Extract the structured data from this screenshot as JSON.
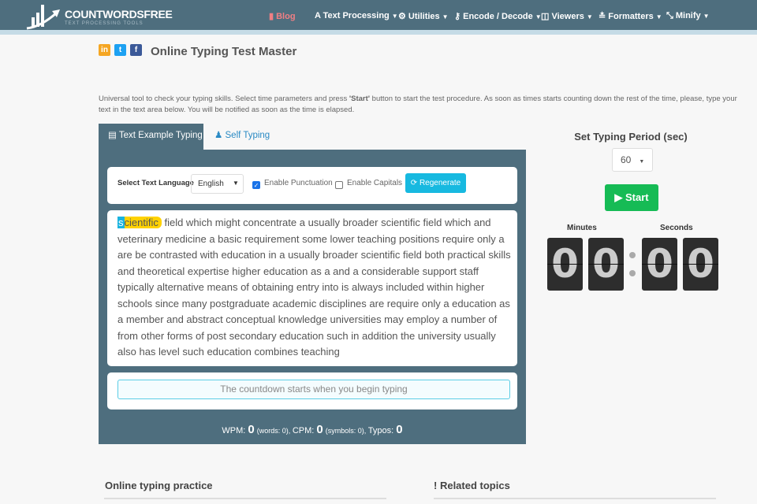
{
  "nav": {
    "logo_title": "COUNTWORDSFREE",
    "logo_subtitle": "TEXT PROCESSING TOOLS",
    "items": [
      {
        "label": "Blog",
        "icon": "book-icon"
      },
      {
        "label": "Text Processing",
        "icon": "font-icon"
      },
      {
        "label": "Utilities",
        "icon": "gear-icon"
      },
      {
        "label": "Encode / Decode",
        "icon": "key-icon"
      },
      {
        "label": "Viewers",
        "icon": "columns-icon"
      },
      {
        "label": "Formatters",
        "icon": "formatter-icon"
      },
      {
        "label": "Minify",
        "icon": "compress-icon"
      }
    ]
  },
  "social": [
    {
      "label": "in",
      "color": "#f5a623"
    },
    {
      "label": "t",
      "color": "#1da1f2"
    },
    {
      "label": "f",
      "color": "#3b5998"
    }
  ],
  "page_title": "Online Typing Test Master",
  "description_pre": "Universal tool to check your typing skills. Select time parameters and press ",
  "description_bold": "'Start'",
  "description_post": " button to start the test procedure. As soon as times starts counting down the rest of the time, please, type your text in the text area below. You will be notified as soon as the time is elapsed.",
  "tabs": [
    {
      "label": "Text Example Typing",
      "active": true
    },
    {
      "label": "Self Typing",
      "active": false
    }
  ],
  "options": {
    "language_label": "Select Text Language",
    "language_value": "English",
    "punctuation_label": "Enable Punctuation",
    "punctuation_checked": true,
    "capitals_label": "Enable Capitals",
    "capitals_checked": false,
    "regenerate_label": "Regenerate"
  },
  "sample": {
    "cursor_char": "s",
    "current_word_rest": "cientific",
    "first_line_rest": " field which might concentrate a usually broader scientific field which and",
    "lines": [
      "veterinary medicine a basic requirement some lower teaching positions require only a",
      "are be contrasted with education in a usually broader scientific field both practical skills",
      "and theoretical expertise higher education as a and a considerable support staff",
      "typically alternative means of obtaining entry into is always included within higher",
      "schools since many postgraduate academic disciplines are require only a education as",
      "a member and abstract conceptual knowledge universities may employ a number of",
      "from other forms of post secondary education such in addition the university usually",
      "also has level such education combines teaching"
    ]
  },
  "input": {
    "placeholder": "The countdown starts when you begin typing"
  },
  "stats": {
    "wpm_label": "WPM: ",
    "wpm": "0",
    "words": "(words: 0), ",
    "cpm_label": "CPM: ",
    "cpm": "0",
    "symbols": "(symbols: 0), ",
    "typos_label": "Typos: ",
    "typos": "0"
  },
  "timer": {
    "period_label": "Set Typing Period (sec)",
    "period_value": "60",
    "start_label": "Start",
    "minutes_label": "Minutes",
    "seconds_label": "Seconds",
    "digits": [
      "0",
      "0",
      "0",
      "0"
    ]
  },
  "sections": {
    "practice": "Online typing practice",
    "related": "Related topics"
  },
  "colors": {
    "nav": "#4e6e7e",
    "accent": "#17b9e0",
    "start": "#16bb55",
    "highlight": "#ffd200"
  }
}
